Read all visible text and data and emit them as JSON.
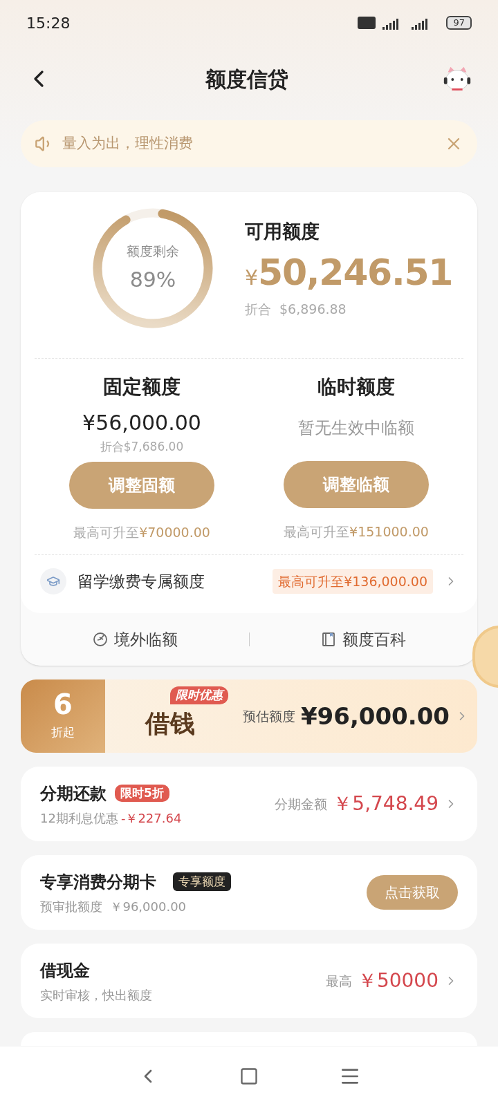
{
  "status_bar": {
    "time": "15:28",
    "battery": "97"
  },
  "header": {
    "title": "额度信贷"
  },
  "notice": {
    "text": "量入为出，理性消费"
  },
  "credit": {
    "gauge_label": "额度剩余",
    "gauge_value": "89%",
    "title": "可用额度",
    "currency": "¥",
    "amount": "50,246.51",
    "converted_label": "折合",
    "converted": "$6,896.88"
  },
  "limits": [
    {
      "title": "固定额度",
      "amount": "¥56,000.00",
      "converted": "折合$7,686.00",
      "button": "调整固额",
      "max_label": "最高可升至",
      "max_value": "¥70000.00"
    },
    {
      "title": "临时额度",
      "note": "暂无生效中临额",
      "button": "调整临额",
      "max_label": "最高可升至",
      "max_value": "¥151000.00"
    }
  ],
  "study": {
    "label": "留学缴费专属额度",
    "tag": "最高可升至¥136,000.00"
  },
  "links": [
    {
      "kind": "plane",
      "label": "境外临额"
    },
    {
      "kind": "book",
      "label": "额度百科"
    }
  ],
  "loan_banner": {
    "discount": "6",
    "discount_unit": "折起",
    "title": "借钱",
    "badge": "限时优惠",
    "amount_label": "预估额度",
    "amount": "¥96,000.00"
  },
  "products": [
    {
      "kind": "installment",
      "title": "分期还款",
      "badge": "限时5折",
      "sub": "12期利息优惠",
      "sub_value": "-￥227.64",
      "value_label": "分期金额",
      "value": "￥5,748.49"
    },
    {
      "kind": "card",
      "title": "专享消费分期卡",
      "badge": "专享额度",
      "sub": "预审批额度  ￥96,000.00",
      "button": "点击获取"
    },
    {
      "kind": "cash",
      "title": "借现金",
      "sub": "实时审核，快出额度",
      "value_label": "最高",
      "value": "￥50000"
    },
    {
      "kind": "empty"
    }
  ]
}
